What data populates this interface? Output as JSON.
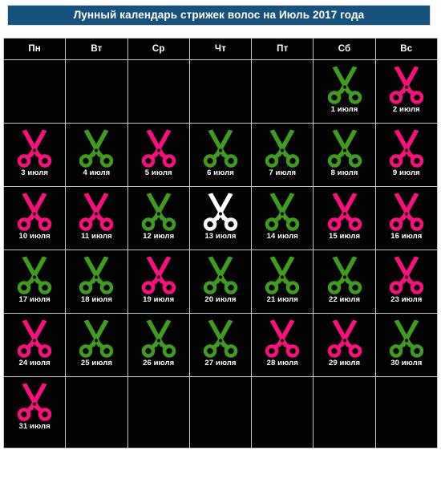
{
  "header": {
    "title": "Лунный календарь стрижек волос на Июль 2017 года",
    "background_color": "#15527d",
    "text_color": "#ffffff"
  },
  "colors": {
    "favorable_green": "#3f9c1f",
    "unfavorable_pink": "#fa0f7c",
    "neutral_white": "#ffffff",
    "cell_background": "#030303",
    "grid_border": "#c4c8cb",
    "page_background": "#ffffff"
  },
  "weekdays": [
    {
      "short": "Пн",
      "name": "monday"
    },
    {
      "short": "Вт",
      "name": "tuesday"
    },
    {
      "short": "Ср",
      "name": "wednesday"
    },
    {
      "short": "Чт",
      "name": "thursday"
    },
    {
      "short": "Пт",
      "name": "friday"
    },
    {
      "short": "Сб",
      "name": "saturday"
    },
    {
      "short": "Вс",
      "name": "sunday"
    }
  ],
  "month": "Июль",
  "year": "2017",
  "weeks": [
    [
      {
        "empty": true
      },
      {
        "empty": true
      },
      {
        "empty": true
      },
      {
        "empty": true
      },
      {
        "empty": true
      },
      {
        "empty": false,
        "day": "1",
        "label": "1 июля",
        "icon": "scissors-icon",
        "color": "green"
      },
      {
        "empty": false,
        "day": "2",
        "label": "2 июля",
        "icon": "scissors-icon",
        "color": "pink"
      }
    ],
    [
      {
        "empty": false,
        "day": "3",
        "label": "3 июля",
        "icon": "scissors-icon",
        "color": "pink"
      },
      {
        "empty": false,
        "day": "4",
        "label": "4 июля",
        "icon": "scissors-icon",
        "color": "green"
      },
      {
        "empty": false,
        "day": "5",
        "label": "5 июля",
        "icon": "scissors-icon",
        "color": "pink"
      },
      {
        "empty": false,
        "day": "6",
        "label": "6 июля",
        "icon": "scissors-icon",
        "color": "green"
      },
      {
        "empty": false,
        "day": "7",
        "label": "7 июля",
        "icon": "scissors-icon",
        "color": "green"
      },
      {
        "empty": false,
        "day": "8",
        "label": "8 июля",
        "icon": "scissors-icon",
        "color": "green"
      },
      {
        "empty": false,
        "day": "9",
        "label": "9 июля",
        "icon": "scissors-icon",
        "color": "pink"
      }
    ],
    [
      {
        "empty": false,
        "day": "10",
        "label": "10 июля",
        "icon": "scissors-icon",
        "color": "pink"
      },
      {
        "empty": false,
        "day": "11",
        "label": "11 июля",
        "icon": "scissors-icon",
        "color": "pink"
      },
      {
        "empty": false,
        "day": "12",
        "label": "12 июля",
        "icon": "scissors-icon",
        "color": "green"
      },
      {
        "empty": false,
        "day": "13",
        "label": "13 июля",
        "icon": "scissors-icon",
        "color": "white"
      },
      {
        "empty": false,
        "day": "14",
        "label": "14 июля",
        "icon": "scissors-icon",
        "color": "green"
      },
      {
        "empty": false,
        "day": "15",
        "label": "15 июля",
        "icon": "scissors-icon",
        "color": "pink"
      },
      {
        "empty": false,
        "day": "16",
        "label": "16 июля",
        "icon": "scissors-icon",
        "color": "pink"
      }
    ],
    [
      {
        "empty": false,
        "day": "17",
        "label": "17 июля",
        "icon": "scissors-icon",
        "color": "green"
      },
      {
        "empty": false,
        "day": "18",
        "label": "18 июля",
        "icon": "scissors-icon",
        "color": "green"
      },
      {
        "empty": false,
        "day": "19",
        "label": "19 июля",
        "icon": "scissors-icon",
        "color": "pink"
      },
      {
        "empty": false,
        "day": "20",
        "label": "20 июля",
        "icon": "scissors-icon",
        "color": "green"
      },
      {
        "empty": false,
        "day": "21",
        "label": "21 июля",
        "icon": "scissors-icon",
        "color": "green"
      },
      {
        "empty": false,
        "day": "22",
        "label": "22 июля",
        "icon": "scissors-icon",
        "color": "green"
      },
      {
        "empty": false,
        "day": "23",
        "label": "23 июля",
        "icon": "scissors-icon",
        "color": "pink"
      }
    ],
    [
      {
        "empty": false,
        "day": "24",
        "label": "24 июля",
        "icon": "scissors-icon",
        "color": "pink"
      },
      {
        "empty": false,
        "day": "25",
        "label": "25 июля",
        "icon": "scissors-icon",
        "color": "green"
      },
      {
        "empty": false,
        "day": "26",
        "label": "26 июля",
        "icon": "scissors-icon",
        "color": "green"
      },
      {
        "empty": false,
        "day": "27",
        "label": "27 июля",
        "icon": "scissors-icon",
        "color": "green"
      },
      {
        "empty": false,
        "day": "28",
        "label": "28 июля",
        "icon": "scissors-icon",
        "color": "pink"
      },
      {
        "empty": false,
        "day": "29",
        "label": "29 июля",
        "icon": "scissors-icon",
        "color": "pink"
      },
      {
        "empty": false,
        "day": "30",
        "label": "30 июля",
        "icon": "scissors-icon",
        "color": "green"
      }
    ],
    [
      {
        "empty": false,
        "day": "31",
        "label": "31 июля",
        "icon": "scissors-icon",
        "color": "pink"
      },
      {
        "empty": true
      },
      {
        "empty": true
      },
      {
        "empty": true
      },
      {
        "empty": true
      },
      {
        "empty": true
      },
      {
        "empty": true
      }
    ]
  ]
}
